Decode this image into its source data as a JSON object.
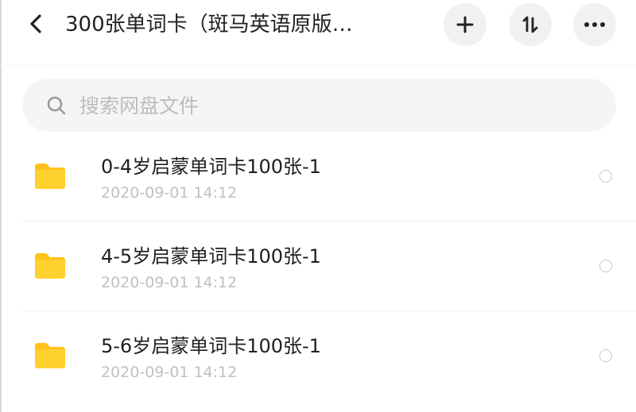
{
  "header": {
    "title": "300张单词卡（斑马英语原版…",
    "back_icon": "chevron-left-icon",
    "actions": [
      {
        "name": "add-button",
        "icon": "plus-icon"
      },
      {
        "name": "sort-button",
        "icon": "sort-icon"
      },
      {
        "name": "more-button",
        "icon": "more-icon"
      }
    ]
  },
  "search": {
    "placeholder": "搜索网盘文件",
    "value": ""
  },
  "files": [
    {
      "name": "0-4岁启蒙单词卡100张-1",
      "time": "2020-09-01  14:12",
      "type": "folder",
      "selected": false
    },
    {
      "name": "4-5岁启蒙单词卡100张-1",
      "time": "2020-09-01  14:12",
      "type": "folder",
      "selected": false
    },
    {
      "name": "5-6岁启蒙单词卡100张-1",
      "time": "2020-09-01  14:12",
      "type": "folder",
      "selected": false
    }
  ],
  "colors": {
    "folder": "#FFD12E",
    "folder_back": "#FFC21A",
    "icon": "#222222",
    "secondary_text": "#C0C0C0",
    "button_bg": "#F1F1F1"
  }
}
